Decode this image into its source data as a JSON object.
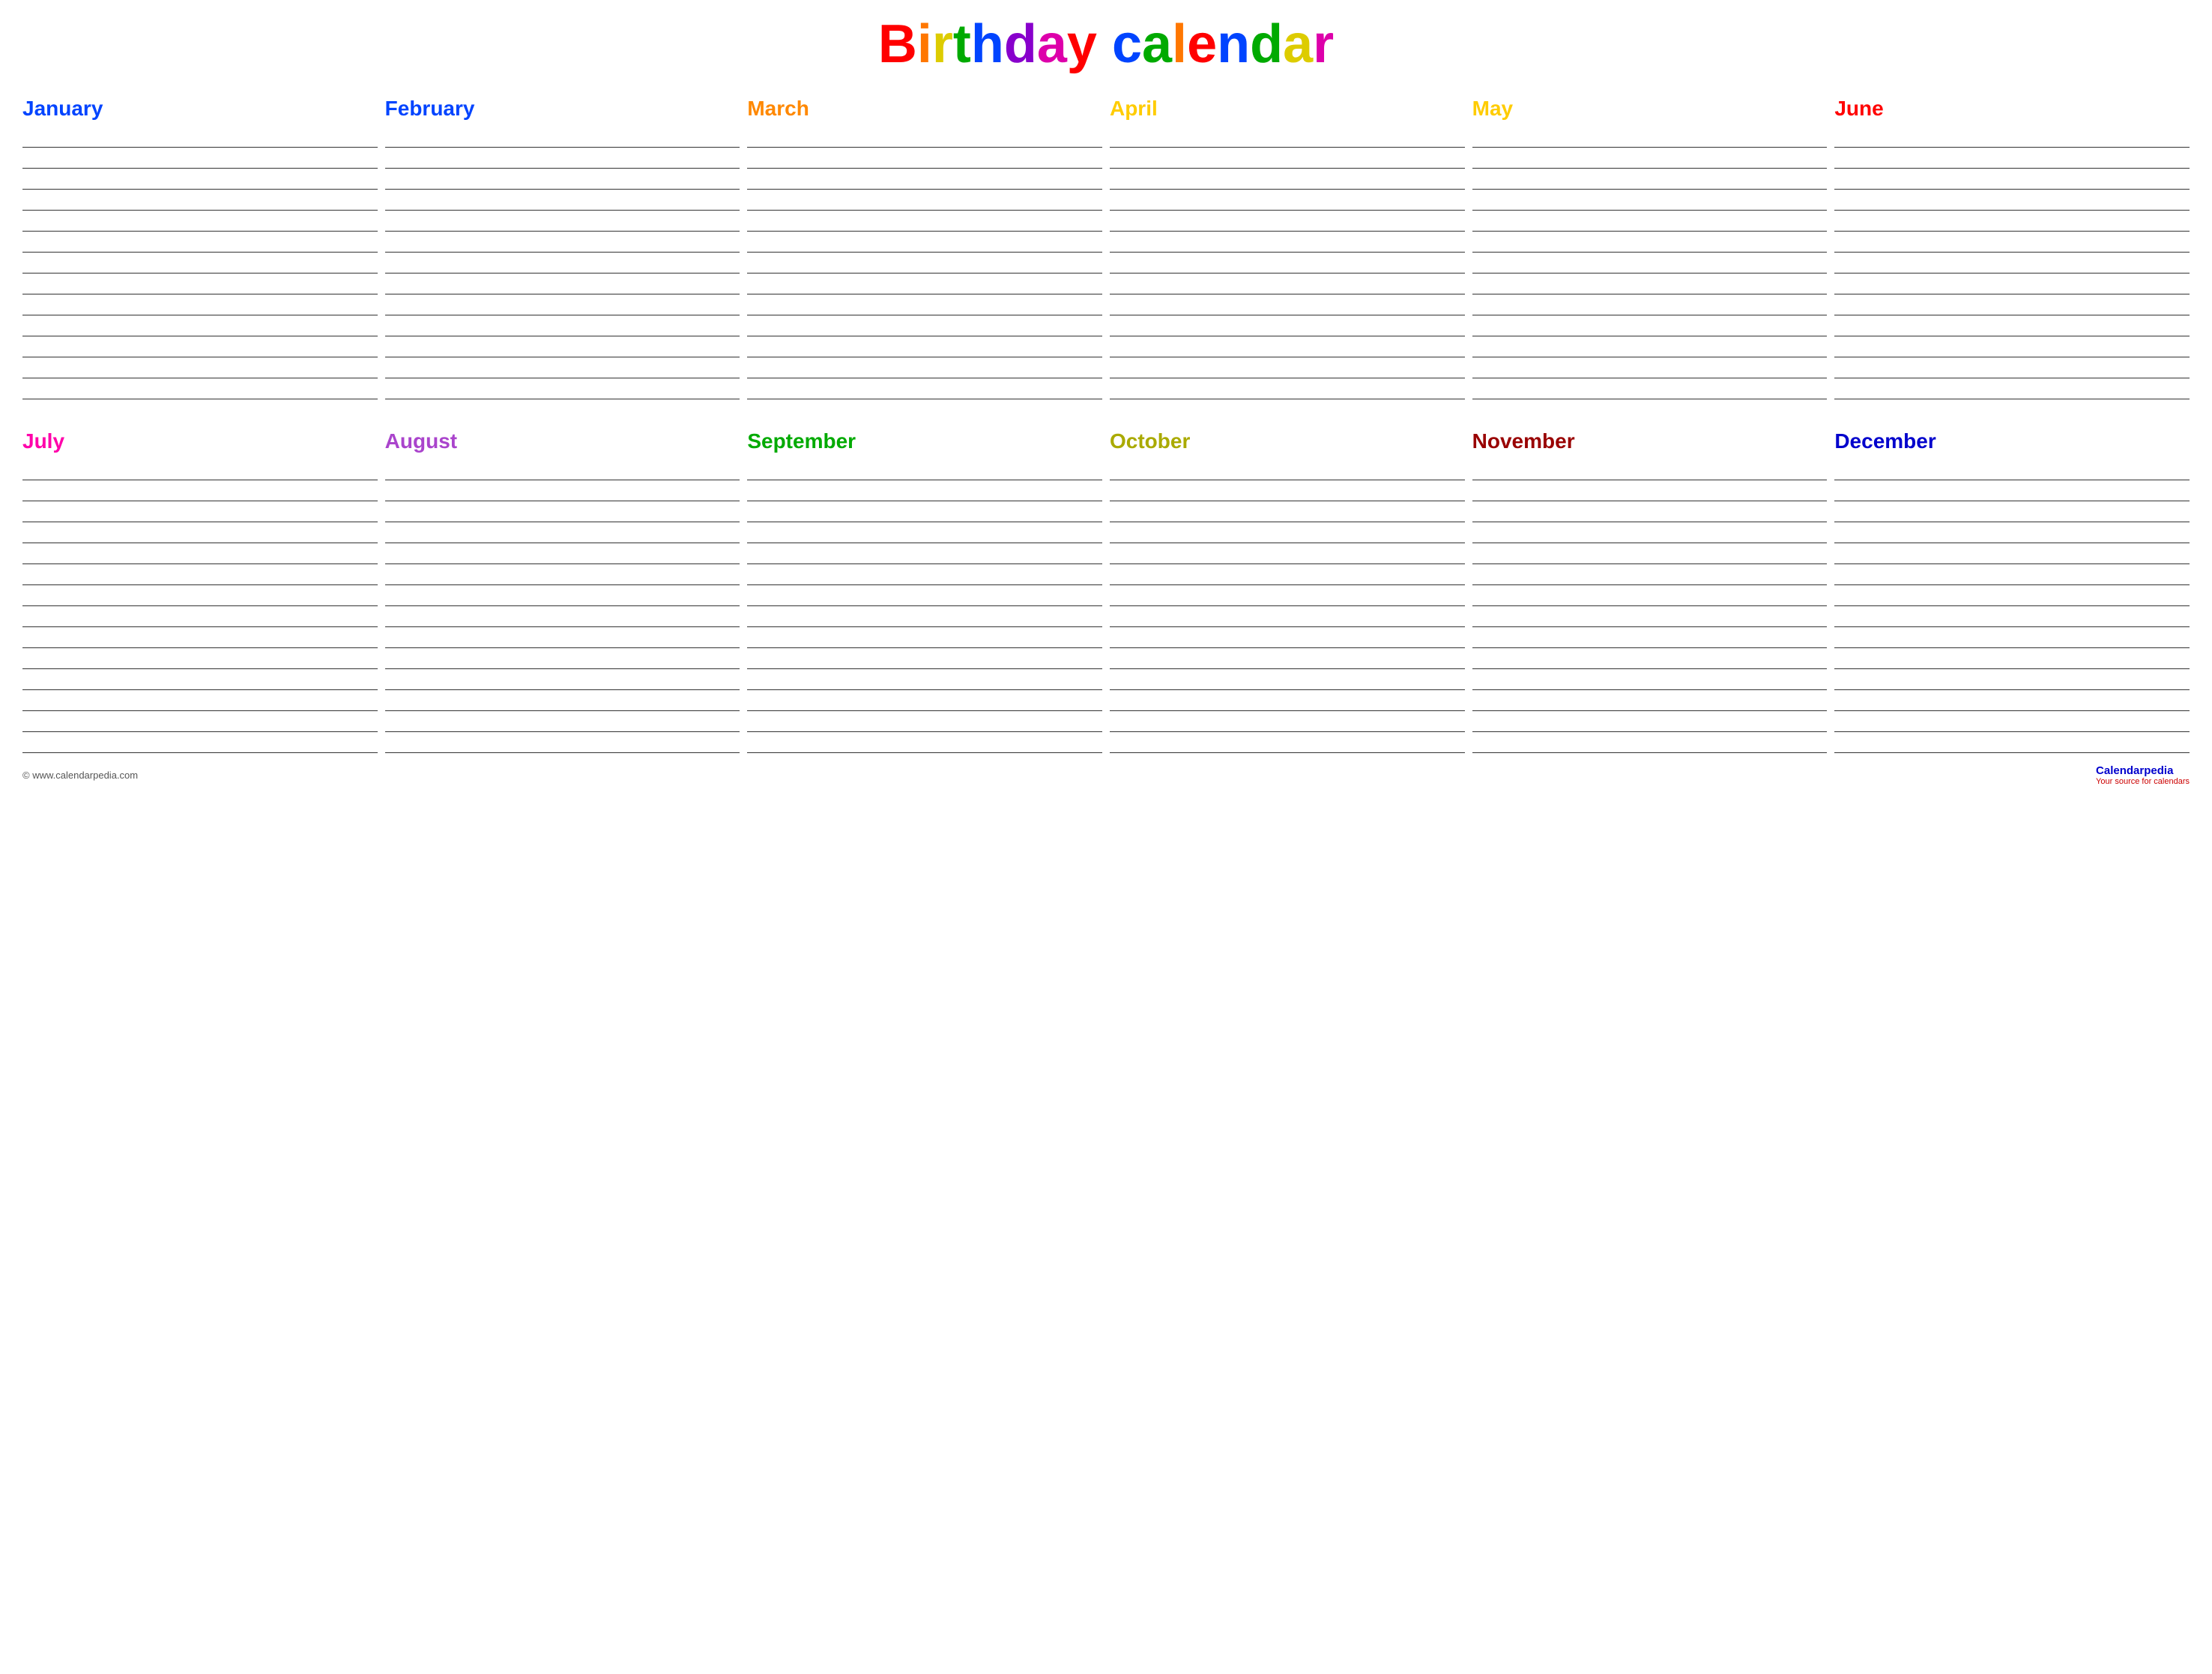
{
  "title": {
    "text": "Birthday calendar",
    "letters": [
      {
        "char": "B",
        "color": "#ff0000"
      },
      {
        "char": "i",
        "color": "#ff7700"
      },
      {
        "char": "r",
        "color": "#ddcc00"
      },
      {
        "char": "t",
        "color": "#00aa00"
      },
      {
        "char": "h",
        "color": "#0044ff"
      },
      {
        "char": "d",
        "color": "#8800cc"
      },
      {
        "char": "a",
        "color": "#dd00aa"
      },
      {
        "char": "y",
        "color": "#ff0000"
      },
      {
        "char": " ",
        "color": "#000000"
      },
      {
        "char": "c",
        "color": "#0044ff"
      },
      {
        "char": "a",
        "color": "#00aa00"
      },
      {
        "char": "l",
        "color": "#ff7700"
      },
      {
        "char": "e",
        "color": "#ff0000"
      },
      {
        "char": "n",
        "color": "#0044ff"
      },
      {
        "char": "d",
        "color": "#00aa00"
      },
      {
        "char": "a",
        "color": "#ddcc00"
      },
      {
        "char": "r",
        "color": "#dd00aa"
      }
    ]
  },
  "rows": [
    {
      "months": [
        {
          "name": "January",
          "color": "#0044ff"
        },
        {
          "name": "February",
          "color": "#0044ff"
        },
        {
          "name": "March",
          "color": "#ff8800"
        },
        {
          "name": "April",
          "color": "#ffcc00"
        },
        {
          "name": "May",
          "color": "#ffcc00"
        },
        {
          "name": "June",
          "color": "#ff0000"
        }
      ],
      "lines": 13
    },
    {
      "months": [
        {
          "name": "July",
          "color": "#ff00aa"
        },
        {
          "name": "August",
          "color": "#aa44cc"
        },
        {
          "name": "September",
          "color": "#00aa00"
        },
        {
          "name": "October",
          "color": "#aaaa00"
        },
        {
          "name": "November",
          "color": "#990000"
        },
        {
          "name": "December",
          "color": "#0000cc"
        }
      ],
      "lines": 14
    }
  ],
  "footer": {
    "left": "© www.calendarpedia.com",
    "right_brand": "Calendarpedia",
    "right_sub": "Your source for calendars"
  }
}
